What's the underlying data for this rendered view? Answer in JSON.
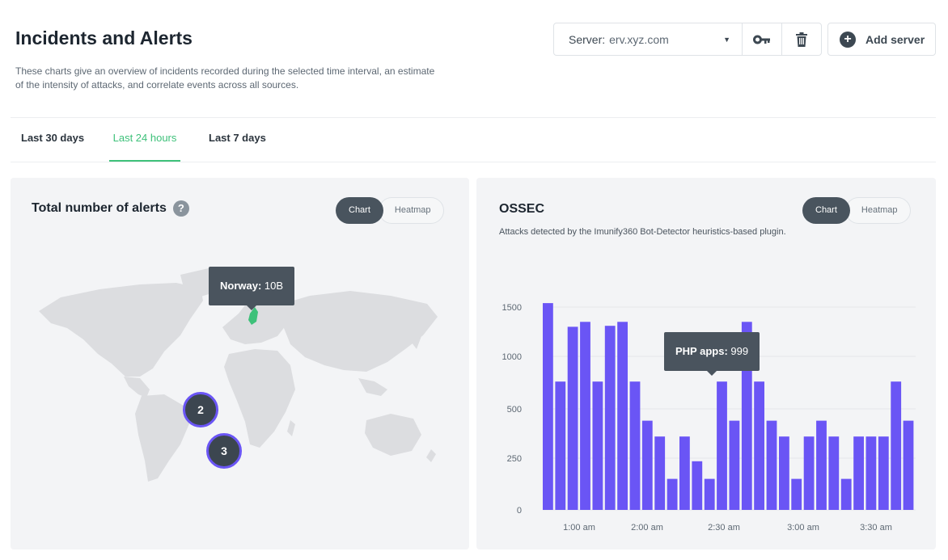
{
  "page": {
    "title": "Incidents and Alerts",
    "description": "These charts give an overview of incidents recorded during the selected time interval, an estimate of the intensity of attacks, and correlate events across all sources."
  },
  "toolbar": {
    "server_label": "Server:",
    "server_value": "erv.xyz.com",
    "key_icon": "key-icon",
    "delete_icon": "trash-icon",
    "add_server_label": "Add server"
  },
  "tabs": [
    {
      "label": "Last 30 days",
      "active": false
    },
    {
      "label": "Last 24 hours",
      "active": true
    },
    {
      "label": "Last 7 days",
      "active": false
    }
  ],
  "colors": {
    "accent": "#3ec17a",
    "bar": "#6a55f5",
    "card_bg": "#f3f4f6",
    "tooltip_bg": "#4a545e"
  },
  "map_card": {
    "title": "Total number of alerts",
    "help_label": "?",
    "toggle_chart": "Chart",
    "toggle_heatmap": "Heatmap",
    "tooltip_country": "Norway:",
    "tooltip_value": "10B",
    "clusters": [
      {
        "label": "2"
      },
      {
        "label": "3"
      }
    ]
  },
  "ossec_card": {
    "title": "OSSEC",
    "subtitle": "Attacks detected by the Imunify360 Bot-Detector heuristics-based plugin.",
    "toggle_chart": "Chart",
    "toggle_heatmap": "Heatmap",
    "tooltip_label": "PHP apps:",
    "tooltip_value": "999"
  },
  "chart_data": {
    "type": "bar",
    "values": [
      1540,
      760,
      1300,
      1350,
      760,
      1310,
      1350,
      760,
      440,
      360,
      150,
      360,
      235,
      150,
      760,
      440,
      1350,
      760,
      440,
      360,
      150,
      360,
      440,
      360,
      150,
      360,
      360,
      360,
      760,
      440
    ],
    "ylim": [
      0,
      1600
    ],
    "yticks": [
      0,
      250,
      500,
      1000,
      1500
    ],
    "xticks": [
      "1:00 am",
      "2:00 am",
      "2:30 am",
      "3:00 am",
      "3:30 am"
    ],
    "grid": true
  }
}
